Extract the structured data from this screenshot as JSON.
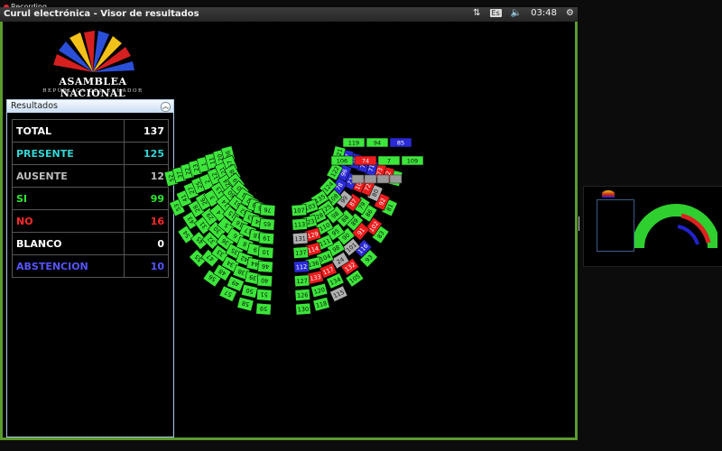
{
  "recording": {
    "label": "Recording"
  },
  "window": {
    "title": "Curul electrónica - Visor de resultados"
  },
  "tray": {
    "keyboard": "Es",
    "clock": "03:48"
  },
  "logo": {
    "name": "ASAMBLEA NACIONAL",
    "subtitle": "REPÚBLICA DEL ECUADOR"
  },
  "panel": {
    "title": "Resultados"
  },
  "results": [
    {
      "label": "TOTAL",
      "value": "137",
      "color": "#ffffff"
    },
    {
      "label": "PRESENTE",
      "value": "125",
      "color": "#33d6d6"
    },
    {
      "label": "AUSENTE",
      "value": "12",
      "color": "#bdbdbd"
    },
    {
      "label": "SI",
      "value": "99",
      "color": "#2ee82e"
    },
    {
      "label": "NO",
      "value": "16",
      "color": "#ff2a2a"
    },
    {
      "label": "BLANCO",
      "value": "0",
      "color": "#ffffff"
    },
    {
      "label": "ABSTENCION",
      "value": "10",
      "color": "#5555ff"
    }
  ],
  "status_colors": {
    "si": "#3ce63a",
    "no": "#ee1c1c",
    "ausente": "#b0b0b0",
    "abstencion": "#2a2ad8"
  },
  "front_rows": [
    [
      {
        "n": "119",
        "s": "si"
      },
      {
        "n": "94",
        "s": "si"
      },
      {
        "n": "85",
        "s": "abstencion"
      }
    ],
    [
      {
        "n": "106",
        "s": "si"
      },
      {
        "n": "74",
        "s": "no"
      },
      {
        "n": "7",
        "s": "si"
      },
      {
        "n": "109",
        "s": "si"
      }
    ]
  ],
  "seats_left": [
    [
      "52",
      "53",
      "54",
      "55",
      "56",
      "57",
      "58",
      "59"
    ],
    [
      "37",
      "41",
      "43",
      "45",
      "47",
      "48",
      "49",
      "50",
      "51"
    ],
    [
      "22",
      "27",
      "28",
      "31",
      "32",
      "33",
      "34",
      "38",
      "39",
      "40"
    ],
    [
      "23",
      "25",
      "26",
      "29",
      "30",
      "36",
      "35",
      "42",
      "44",
      "46"
    ],
    [
      "1",
      "2",
      "3",
      "4",
      "5",
      "6",
      "8",
      "9",
      "10"
    ],
    [
      "11",
      "12",
      "13",
      "14",
      "15",
      "16",
      "17",
      "18",
      "19"
    ],
    [
      "20",
      "21",
      "24",
      "60",
      "61",
      "62",
      "63",
      "64",
      "65"
    ],
    [
      "66",
      "67",
      "68",
      "69",
      "70",
      "71",
      "72",
      "73",
      "75",
      "76"
    ]
  ],
  "seats_right": [
    [
      {
        "n": "75",
        "s": "si"
      },
      {
        "n": "81",
        "s": "si"
      },
      {
        "n": "83",
        "s": "si"
      },
      {
        "n": "93",
        "s": "si"
      },
      {
        "n": "105",
        "s": "si"
      },
      {
        "n": "115",
        "s": "ausente"
      },
      {
        "n": "118",
        "s": "si"
      },
      {
        "n": "130",
        "s": "si"
      }
    ],
    [
      {
        "n": "82",
        "s": "no"
      },
      {
        "n": "92",
        "s": "no"
      },
      {
        "n": "102",
        "s": "no"
      },
      {
        "n": "116",
        "s": "abstencion"
      },
      {
        "n": "132",
        "s": "no"
      },
      {
        "n": "134",
        "s": "si"
      },
      {
        "n": "120",
        "s": "si"
      },
      {
        "n": "126",
        "s": "si"
      }
    ],
    [
      {
        "n": "73",
        "s": "no"
      },
      {
        "n": "80",
        "s": "ausente"
      },
      {
        "n": "86",
        "s": "si"
      },
      {
        "n": "91",
        "s": "no"
      },
      {
        "n": "101",
        "s": "ausente"
      },
      {
        "n": "24",
        "s": "ausente"
      },
      {
        "n": "117",
        "s": "no"
      },
      {
        "n": "133",
        "s": "no"
      },
      {
        "n": "127",
        "s": "si"
      }
    ],
    [
      {
        "n": "71",
        "s": "abstencion"
      },
      {
        "n": "72",
        "s": "no"
      },
      {
        "n": "79",
        "s": "si"
      },
      {
        "n": "89",
        "s": "si"
      },
      {
        "n": "90",
        "s": "si"
      },
      {
        "n": "98",
        "s": "si"
      },
      {
        "n": "104",
        "s": "si"
      },
      {
        "n": "136",
        "s": "si"
      },
      {
        "n": "112",
        "s": "abstencion"
      }
    ],
    [
      {
        "n": "70",
        "s": "abstencion"
      },
      {
        "n": "100",
        "s": "no"
      },
      {
        "n": "87",
        "s": "no"
      },
      {
        "n": "88",
        "s": "si"
      },
      {
        "n": "95",
        "s": "si"
      },
      {
        "n": "111",
        "s": "si"
      },
      {
        "n": "114",
        "s": "no"
      },
      {
        "n": "137",
        "s": "si"
      }
    ],
    [
      {
        "n": "76",
        "s": "abstencion"
      },
      {
        "n": "77",
        "s": "abstencion"
      },
      {
        "n": "99",
        "s": "ausente"
      },
      {
        "n": "98",
        "s": "si"
      },
      {
        "n": "110",
        "s": "si"
      },
      {
        "n": "129",
        "s": "no"
      },
      {
        "n": "131",
        "s": "ausente"
      }
    ],
    [
      {
        "n": "97",
        "s": "abstencion"
      },
      {
        "n": "96",
        "s": "abstencion"
      },
      {
        "n": "78",
        "s": "abstencion"
      },
      {
        "n": "108",
        "s": "si"
      },
      {
        "n": "125",
        "s": "si"
      },
      {
        "n": "128",
        "s": "si"
      },
      {
        "n": "123",
        "s": "si"
      },
      {
        "n": "113",
        "s": "si"
      }
    ],
    [
      {
        "n": "121",
        "s": "si"
      },
      {
        "n": "122",
        "s": "si"
      },
      {
        "n": "124",
        "s": "si"
      },
      {
        "n": "135",
        "s": "si"
      },
      {
        "n": "103",
        "s": "si"
      },
      {
        "n": "107",
        "s": "si"
      }
    ]
  ]
}
